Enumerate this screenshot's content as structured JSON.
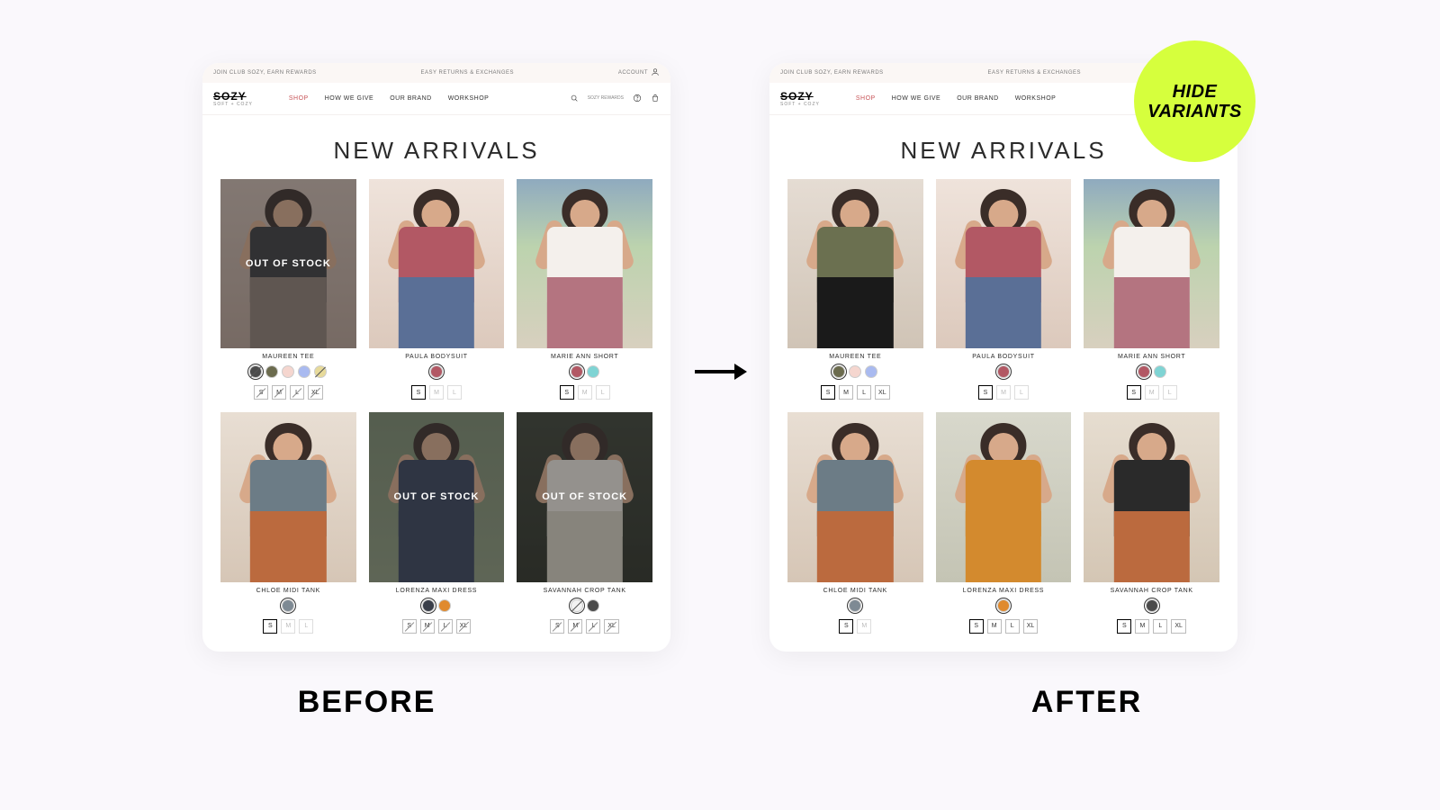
{
  "labels": {
    "before": "BEFORE",
    "after": "AFTER"
  },
  "badge": {
    "line1": "HIDE",
    "line2": "VARIANTS"
  },
  "topbar": {
    "left": "JOIN CLUB SOZY, EARN REWARDS",
    "center": "EASY RETURNS & EXCHANGES",
    "right": "ACCOUNT"
  },
  "brand": {
    "name": "SOZY",
    "sub": "SOFT + COZY"
  },
  "nav": {
    "shop": "SHOP",
    "give": "HOW WE GIVE",
    "brand": "OUR BRAND",
    "workshop": "WORKSHOP",
    "rewards": "SOZY\nREWARDS"
  },
  "title": "NEW ARRIVALS",
  "oos": "OUT OF STOCK",
  "products": {
    "before": [
      {
        "name": "MAUREEN TEE",
        "img": "tee-dark",
        "oos": true,
        "colors": [
          {
            "c": "#4b4b4b",
            "sel": true,
            "strike": true
          },
          {
            "c": "#6b6b4e"
          },
          {
            "c": "#f5d6cf"
          },
          {
            "c": "#a9baf0"
          },
          {
            "c": "#e7da9a",
            "strike": true
          }
        ],
        "sizes": [
          {
            "s": "S",
            "strike": true
          },
          {
            "s": "M",
            "strike": true
          },
          {
            "s": "L",
            "strike": true
          },
          {
            "s": "XL",
            "strike": true
          }
        ]
      },
      {
        "name": "PAULA BODYSUIT",
        "img": "bodysuit",
        "colors": [
          {
            "c": "#b25864",
            "sel": true
          }
        ],
        "sizes": [
          {
            "s": "S",
            "sel": true
          },
          {
            "s": "M",
            "unav": true
          },
          {
            "s": "L",
            "unav": true
          }
        ]
      },
      {
        "name": "MARIE ANN SHORT",
        "img": "short",
        "colors": [
          {
            "c": "#b25864",
            "sel": true
          },
          {
            "c": "#7fd4d4"
          }
        ],
        "sizes": [
          {
            "s": "S",
            "sel": true
          },
          {
            "s": "M",
            "unav": true
          },
          {
            "s": "L",
            "unav": true
          }
        ]
      },
      {
        "name": "CHLOE MIDI TANK",
        "img": "tank-blue",
        "colors": [
          {
            "c": "#7e8a94",
            "sel": true
          }
        ],
        "sizes": [
          {
            "s": "S",
            "sel": true
          },
          {
            "s": "M",
            "unav": true
          },
          {
            "s": "L",
            "unav": true
          }
        ]
      },
      {
        "name": "LORENZA MAXI DRESS",
        "img": "maxi-navy",
        "oos": true,
        "colors": [
          {
            "c": "#3a3f4a",
            "sel": true
          },
          {
            "c": "#e08a2e"
          }
        ],
        "sizes": [
          {
            "s": "S",
            "strike": true
          },
          {
            "s": "M",
            "strike": true
          },
          {
            "s": "L",
            "strike": true
          },
          {
            "s": "XL",
            "strike": true
          }
        ]
      },
      {
        "name": "SAVANNAH CROP TANK",
        "img": "crop-white",
        "oos": true,
        "colors": [
          {
            "c": "#f2f2f2",
            "sel": true,
            "strike": true
          },
          {
            "c": "#4a4a4a"
          }
        ],
        "sizes": [
          {
            "s": "S",
            "strike": true
          },
          {
            "s": "M",
            "strike": true
          },
          {
            "s": "L",
            "strike": true
          },
          {
            "s": "XL",
            "strike": true
          }
        ]
      }
    ],
    "after": [
      {
        "name": "MAUREEN TEE",
        "img": "tee-olive",
        "colors": [
          {
            "c": "#6b6b4e",
            "sel": true
          },
          {
            "c": "#f5d6cf"
          },
          {
            "c": "#a9baf0"
          }
        ],
        "sizes": [
          {
            "s": "S",
            "sel": true
          },
          {
            "s": "M"
          },
          {
            "s": "L"
          },
          {
            "s": "XL"
          }
        ]
      },
      {
        "name": "PAULA BODYSUIT",
        "img": "bodysuit",
        "colors": [
          {
            "c": "#b25864",
            "sel": true
          }
        ],
        "sizes": [
          {
            "s": "S",
            "sel": true
          },
          {
            "s": "M",
            "unav": true
          },
          {
            "s": "L",
            "unav": true
          }
        ]
      },
      {
        "name": "MARIE ANN SHORT",
        "img": "short",
        "colors": [
          {
            "c": "#b25864",
            "sel": true
          },
          {
            "c": "#7fd4d4"
          }
        ],
        "sizes": [
          {
            "s": "S",
            "sel": true
          },
          {
            "s": "M",
            "unav": true
          },
          {
            "s": "L",
            "unav": true
          }
        ]
      },
      {
        "name": "CHLOE MIDI TANK",
        "img": "tank-blue",
        "colors": [
          {
            "c": "#7e8a94",
            "sel": true
          }
        ],
        "sizes": [
          {
            "s": "S",
            "sel": true
          },
          {
            "s": "M",
            "unav": true
          }
        ]
      },
      {
        "name": "LORENZA MAXI DRESS",
        "img": "maxi-orange",
        "colors": [
          {
            "c": "#e08a2e",
            "sel": true
          }
        ],
        "sizes": [
          {
            "s": "S",
            "sel": true
          },
          {
            "s": "M"
          },
          {
            "s": "L"
          },
          {
            "s": "XL"
          }
        ]
      },
      {
        "name": "SAVANNAH CROP TANK",
        "img": "crop-black",
        "colors": [
          {
            "c": "#4a4a4a",
            "sel": true
          }
        ],
        "sizes": [
          {
            "s": "S",
            "sel": true
          },
          {
            "s": "M"
          },
          {
            "s": "L"
          },
          {
            "s": "XL"
          }
        ]
      }
    ]
  },
  "imgStyles": {
    "tee-dark": {
      "bg": "linear-gradient(#cdbab0,#b8a195)",
      "torso": "#3a3a3c",
      "legs": "#8d7c74"
    },
    "tee-olive": {
      "bg": "linear-gradient(#e5dcd3,#d0c4b6)",
      "torso": "#6b7050",
      "legs": "#1a1a1a"
    },
    "bodysuit": {
      "bg": "linear-gradient(#efe3db,#dcc9bc)",
      "torso": "#b25864",
      "legs": "#5a6f96"
    },
    "short": {
      "bg": "linear-gradient(180deg,#8faabf 0%,#bcd3ae 40%,#d8d0bf 100%)",
      "torso": "#f4f0ec",
      "legs": "#b47480"
    },
    "tank-blue": {
      "bg": "linear-gradient(#e8ded3,#d6c6b6)",
      "torso": "#6c7c86",
      "legs": "#bb6a3e"
    },
    "maxi-navy": {
      "bg": "linear-gradient(#7a8a6f,#8b987c)",
      "torso": "#36405a",
      "legs": "#36405a"
    },
    "maxi-orange": {
      "bg": "linear-gradient(#d8d8cc,#c4c4b4)",
      "torso": "#d38a2e",
      "legs": "#d38a2e"
    },
    "crop-white": {
      "bg": "linear-gradient(#3a3f34,#2a2e24)",
      "torso": "#ede8e0",
      "legs": "#d6d0c2"
    },
    "crop-black": {
      "bg": "linear-gradient(#e6ddd0,#d4c6b4)",
      "torso": "#2a2a2a",
      "legs": "#bb6a3e"
    }
  }
}
